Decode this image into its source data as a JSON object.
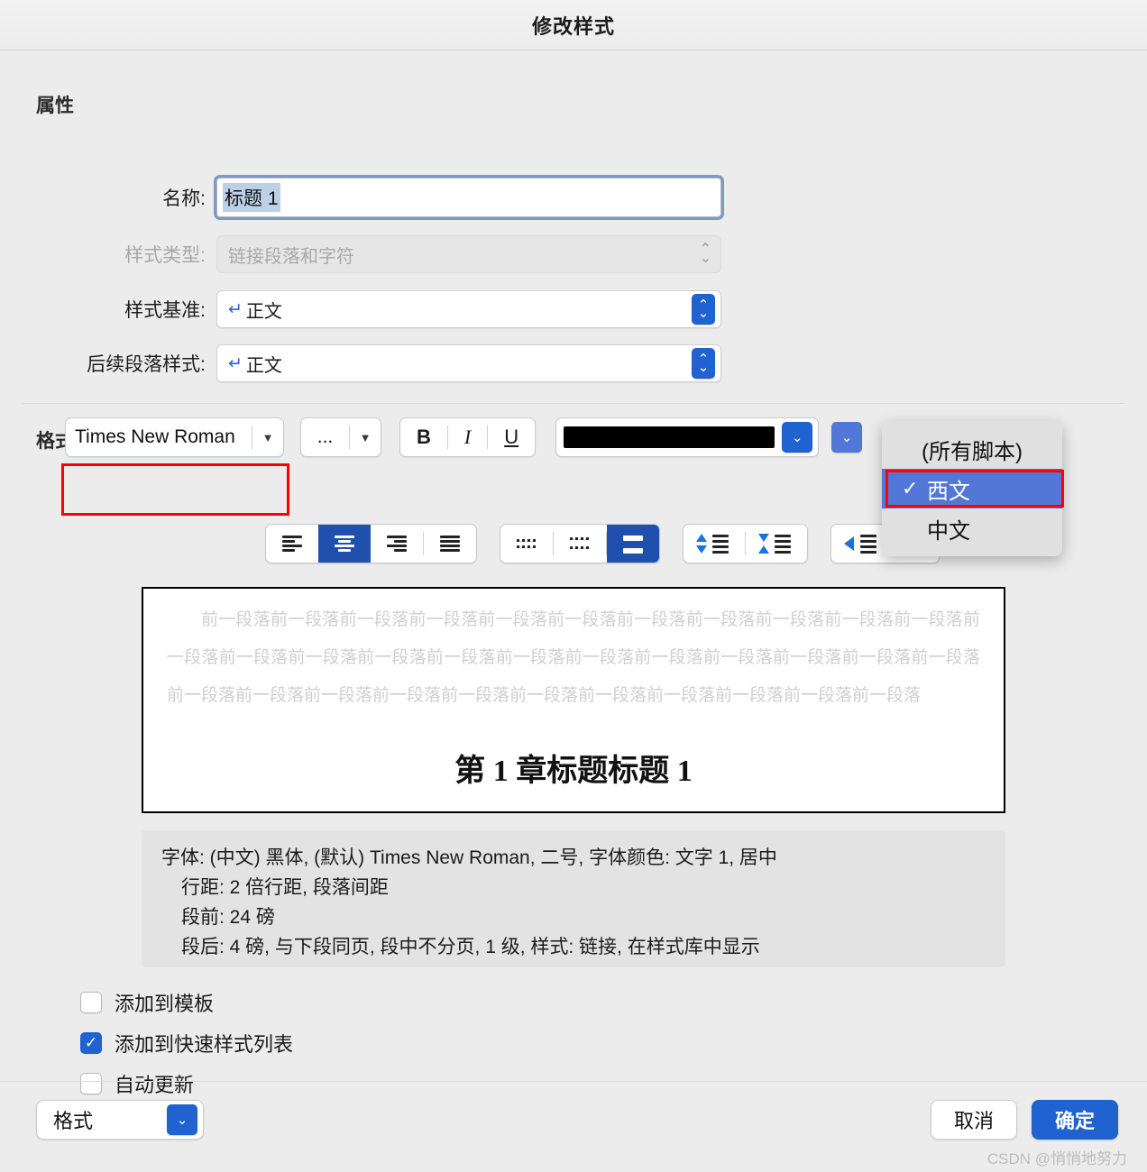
{
  "dialog": {
    "title": "修改样式"
  },
  "properties": {
    "section_label": "属性",
    "name_label": "名称:",
    "name_value": "标题 1",
    "style_type_label": "样式类型:",
    "style_type_value": "链接段落和字符",
    "style_base_label": "样式基准:",
    "style_base_value": "正文",
    "next_style_label": "后续段落样式:",
    "next_style_value": "正文",
    "pilcrow_glyph": "↵"
  },
  "format": {
    "section_label": "格式",
    "font_name": "Times New Roman",
    "font_size": "...",
    "bold_label": "B",
    "italic_label": "I",
    "underline_label": "U",
    "font_color": "#000000",
    "accent_color": "#1f62d0",
    "highlight_color": "#ff0000",
    "selected_alignment": "center",
    "selected_line_spacing": "double"
  },
  "script_menu": {
    "items": [
      {
        "label": "(所有脚本)",
        "checked": false,
        "selected": false
      },
      {
        "label": "西文",
        "checked": true,
        "selected": true
      },
      {
        "label": "中文",
        "checked": false,
        "selected": false
      }
    ],
    "check_glyph": "✓"
  },
  "preview": {
    "paragraph": "前一段落前一段落前一段落前一段落前一段落前一段落前一段落前一段落前一段落前一段落前一段落前一段落前一段落前一段落前一段落前一段落前一段落前一段落前一段落前一段落前一段落前一段落前一段落前一段落前一段落前一段落前一段落前一段落前一段落前一段落前一段落前一段落前一段落前一段落",
    "headline": "第 1 章标题标题 1"
  },
  "description": {
    "lines": [
      "字体: (中文) 黑体, (默认) Times New Roman, 二号, 字体颜色: 文字 1, 居中",
      "行距: 2 倍行距, 段落间距",
      "段前: 24 磅",
      "段后: 4 磅, 与下段同页, 段中不分页, 1 级, 样式: 链接, 在样式库中显示"
    ]
  },
  "options": [
    {
      "label": "添加到模板",
      "checked": false
    },
    {
      "label": "添加到快速样式列表",
      "checked": true
    },
    {
      "label": "自动更新",
      "checked": false
    }
  ],
  "footer": {
    "format_menu_label": "格式",
    "cancel_label": "取消",
    "ok_label": "确定",
    "watermark": "CSDN @悄悄地努力",
    "check_glyph": "✓",
    "chevron_glyph": "⌄"
  }
}
